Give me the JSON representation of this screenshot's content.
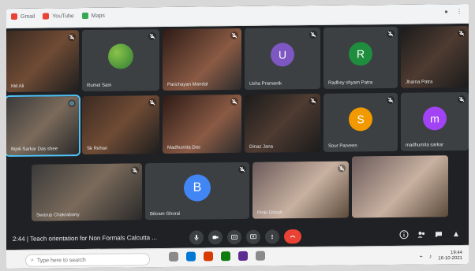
{
  "browser": {
    "bookmarks": [
      {
        "label": "Gmail",
        "icon": "gmail-icon"
      },
      {
        "label": "YouTube",
        "icon": "youtube-icon"
      },
      {
        "label": "Maps",
        "icon": "maps-icon"
      }
    ],
    "right": {
      "profile": "",
      "menu": ""
    }
  },
  "participants": [
    {
      "name": "Md Ali",
      "type": "video"
    },
    {
      "name": "Rumel Sam",
      "type": "photo"
    },
    {
      "name": "Parichayan Mandal",
      "type": "video"
    },
    {
      "name": "Usha Pramanik",
      "type": "avatar",
      "initial": "U",
      "color": "#7e57c2"
    },
    {
      "name": "Radhey shyam Patra",
      "type": "avatar",
      "initial": "R",
      "color": "#1e8e3e"
    },
    {
      "name": "Jharna Patra",
      "type": "video"
    },
    {
      "name": "Bijoli Sarkar Das shee",
      "type": "video",
      "speaking": true
    },
    {
      "name": "Sk Rehan",
      "type": "video"
    },
    {
      "name": "Madhumita Das",
      "type": "video"
    },
    {
      "name": "Dinaz Jana",
      "type": "video"
    },
    {
      "name": "Sour Parveen",
      "type": "avatar",
      "initial": "S",
      "color": "#f29900"
    },
    {
      "name": "madhumita sarkar",
      "type": "avatar",
      "initial": "m",
      "color": "#a142f4"
    },
    {
      "name": "Swarup Chakraborty",
      "type": "video"
    },
    {
      "name": "Bikram Ghorai",
      "type": "avatar",
      "initial": "B",
      "color": "#4285f4"
    },
    {
      "name": "Pinki Ghosh",
      "type": "video"
    },
    {
      "name": "",
      "type": "self"
    }
  ],
  "meeting": {
    "time": "2:44",
    "title": "Teach orientation for Non Formals Calcutta ..."
  },
  "taskbar": {
    "search_placeholder": "Type here to search",
    "time": "19:44",
    "date": "16-10-2021"
  }
}
